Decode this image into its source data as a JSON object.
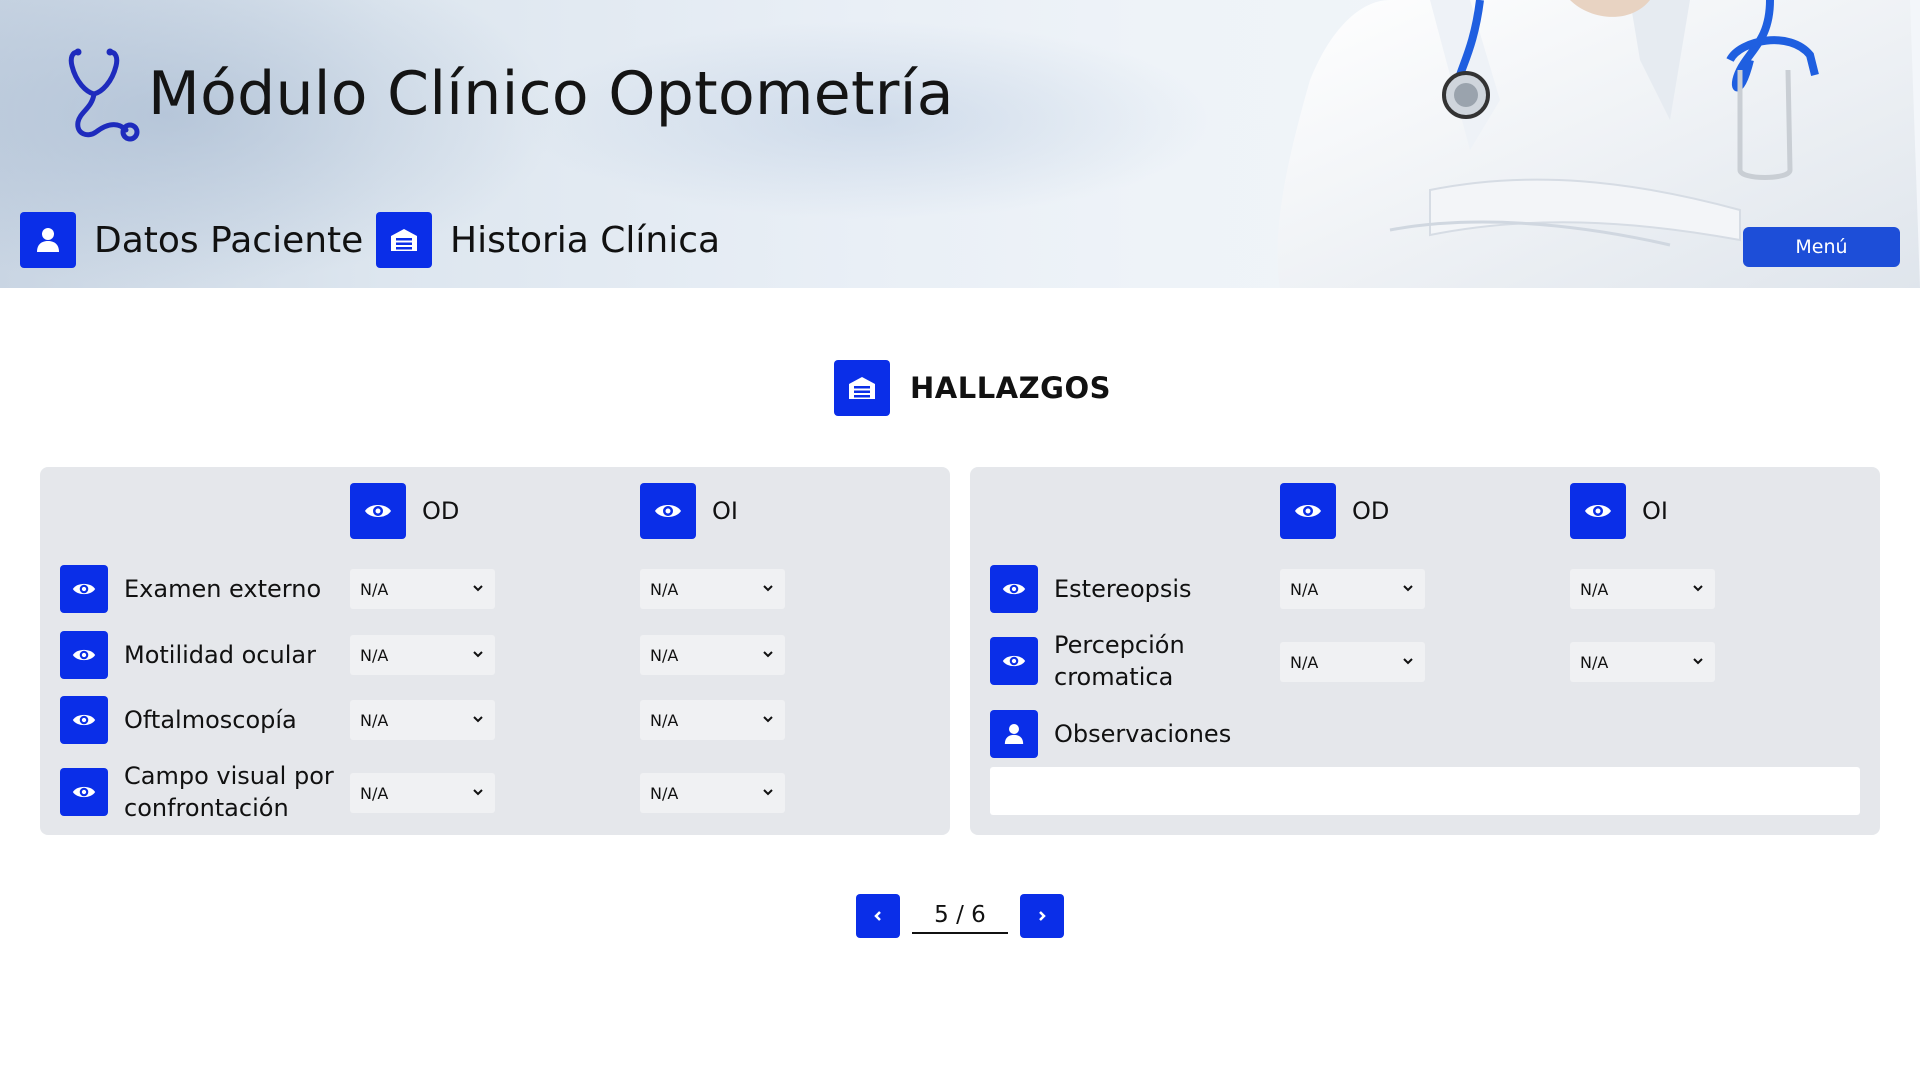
{
  "header": {
    "app_title": "Módulo Clínico Optometría",
    "nav": [
      {
        "label": "Datos Paciente",
        "icon": "user-icon"
      },
      {
        "label": "Historia Clínica",
        "icon": "clinic-icon"
      }
    ],
    "menu_label": "Menú"
  },
  "section": {
    "title": "HALLAZGOS",
    "icon": "clinic-icon"
  },
  "left_panel": {
    "col_od": "OD",
    "col_oi": "OI",
    "rows": [
      {
        "label": "Examen externo",
        "od": "N/A",
        "oi": "N/A"
      },
      {
        "label": "Motilidad ocular",
        "od": "N/A",
        "oi": "N/A"
      },
      {
        "label": "Oftalmoscopía",
        "od": "N/A",
        "oi": "N/A"
      },
      {
        "label_line1": "Campo visual por",
        "label_line2": "confrontación",
        "od": "N/A",
        "oi": "N/A"
      }
    ]
  },
  "right_panel": {
    "col_od": "OD",
    "col_oi": "OI",
    "rows": [
      {
        "label": "Estereopsis",
        "od": "N/A",
        "oi": "N/A"
      },
      {
        "label_line1": "Percepción",
        "label_line2": "cromatica",
        "od": "N/A",
        "oi": "N/A"
      }
    ],
    "observaciones_label": "Observaciones",
    "observaciones_value": ""
  },
  "pagination": {
    "current": "5 / 6"
  },
  "colors": {
    "accent": "#0a2ee8",
    "menu_button": "#1d4ed8",
    "panel_bg": "#e5e7eb"
  }
}
